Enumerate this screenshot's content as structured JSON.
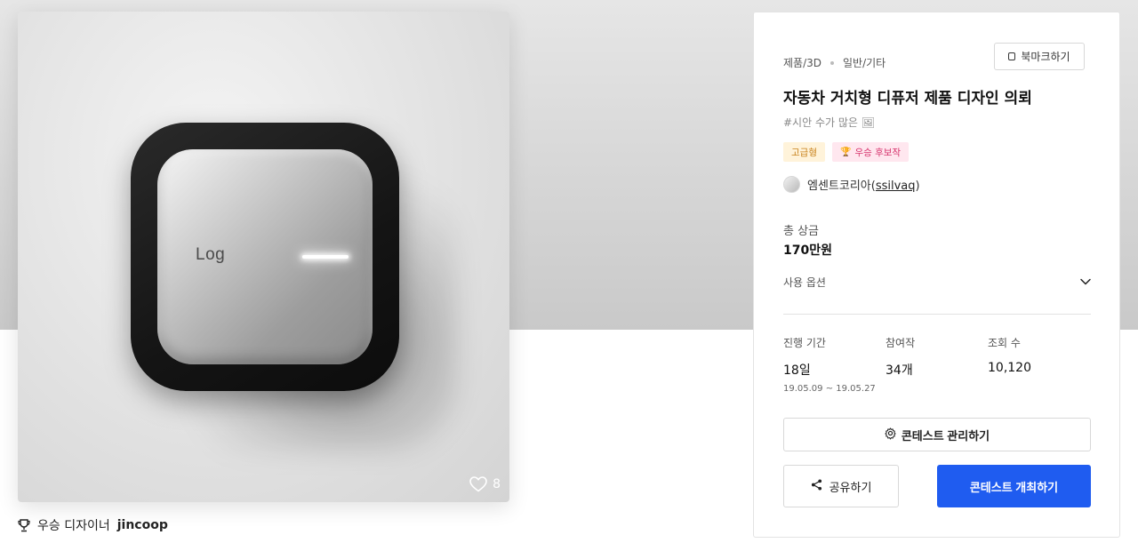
{
  "product_image": {
    "device_logo": "Log",
    "like_count": "8"
  },
  "winner": {
    "prefix": "우승 디자이너",
    "name": "jincoop"
  },
  "panel": {
    "category_main": "제품/3D",
    "category_sub": "일반/기타",
    "bookmark_label": "북마크하기",
    "title": "자동차 거치형 디퓨저 제품 디자인 의뢰",
    "hashtag": "#시안 수가 많은 🖼",
    "badges": {
      "premium": "고급형",
      "candidate": "우승 후보작"
    },
    "designer_name": "엠센트코리아",
    "designer_handle": "ssilvaq",
    "prize_label": "총 상금",
    "prize_value": "170만원",
    "options_label": "사용 옵션",
    "stats": {
      "period_label": "진행 기간",
      "period_value": "18일",
      "period_range": "19.05.09 ~ 19.05.27",
      "participants_label": "참여작",
      "participants_value": "34개",
      "views_label": "조회 수",
      "views_value": "10,120"
    },
    "manage_label": "콘테스트 관리하기",
    "share_label": "공유하기",
    "host_label": "콘테스트 개최하기"
  },
  "colors": {
    "primary": "#1f5cf0",
    "premium_badge_bg": "#fff3da",
    "premium_badge_text": "#c8811a",
    "candidate_badge_bg": "#ffe7ef",
    "candidate_badge_text": "#d6336c"
  },
  "icons": {
    "like": "heart-icon",
    "trophy": "trophy-icon",
    "bookmark": "bookmark-icon",
    "chevron": "chevron-down-icon",
    "settings": "gear-icon",
    "share": "share-icon"
  }
}
